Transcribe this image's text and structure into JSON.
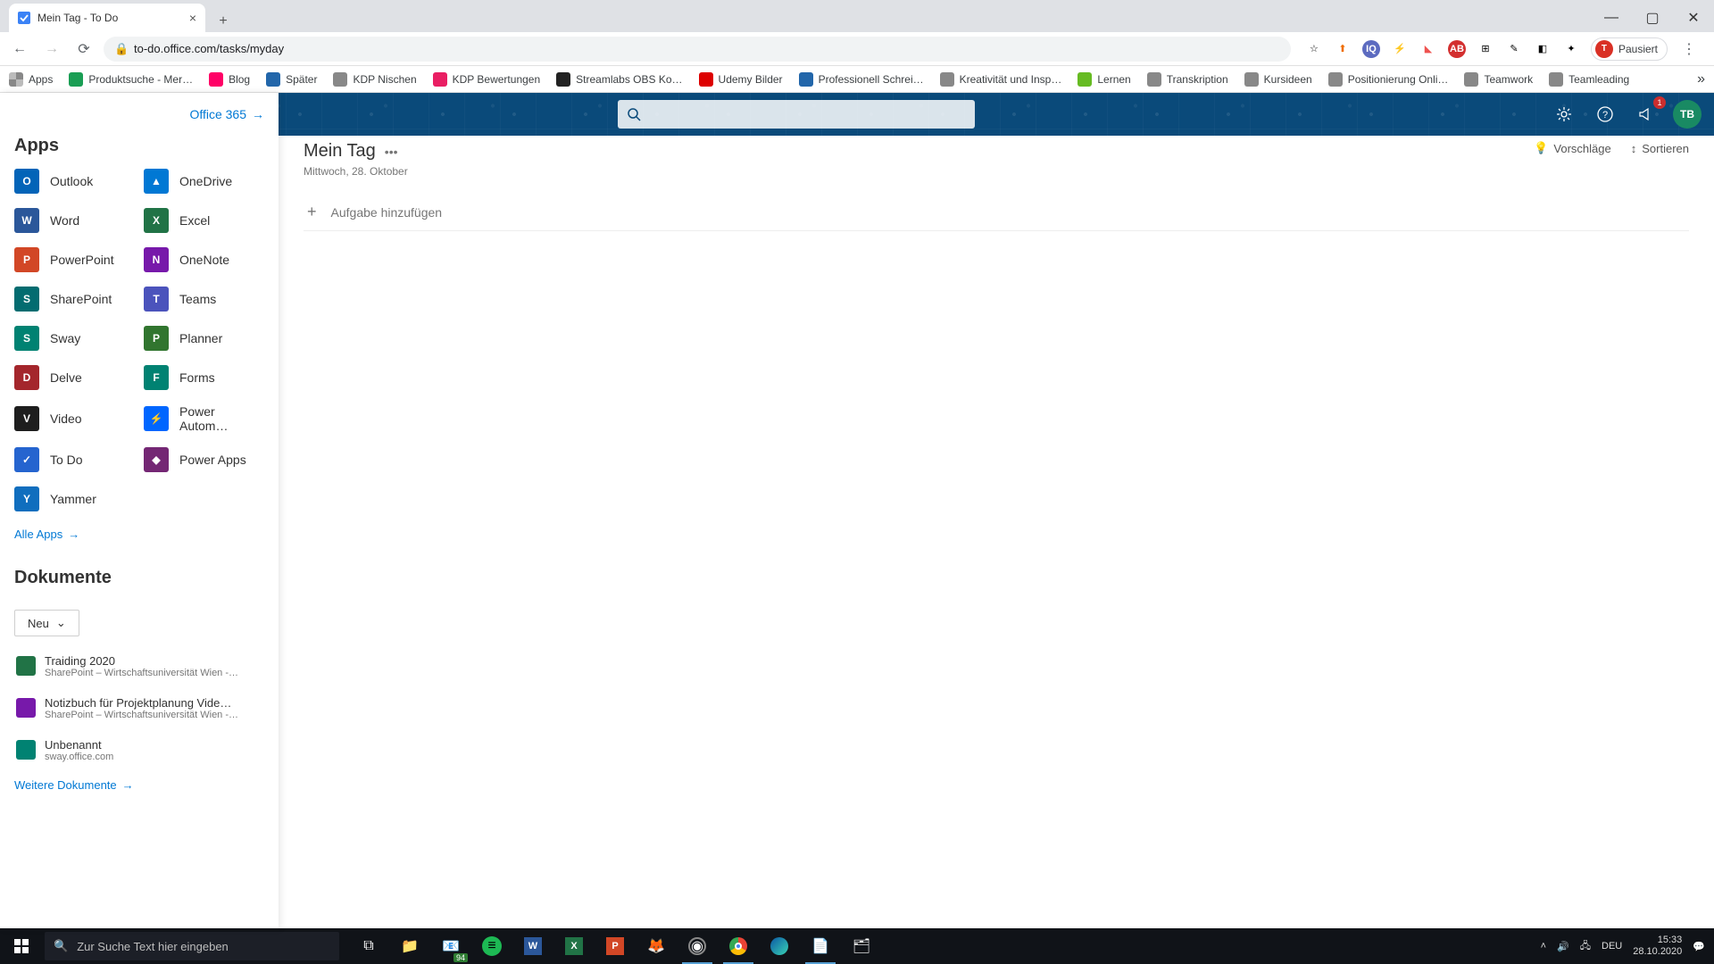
{
  "browser": {
    "tab_title": "Mein Tag - To Do",
    "url": "to-do.office.com/tasks/myday",
    "profile_status": "Pausiert",
    "profile_initial": "T",
    "apps_label": "Apps",
    "bookmarks": [
      "Produktsuche - Mer…",
      "Blog",
      "Später",
      "KDP Nischen",
      "KDP Bewertungen",
      "Streamlabs OBS Ko…",
      "Udemy Bilder",
      "Professionell Schrei…",
      "Kreativität und Insp…",
      "Lernen",
      "Transkription",
      "Kursideen",
      "Positionierung Onli…",
      "Teamwork",
      "Teamleading"
    ]
  },
  "office_header": {
    "notifications_count": "1",
    "avatar_initials": "TB"
  },
  "launcher": {
    "office_link": "Office 365",
    "apps_title": "Apps",
    "all_apps": "Alle Apps",
    "docs_title": "Dokumente",
    "new_label": "Neu",
    "more_docs": "Weitere Dokumente",
    "apps": [
      {
        "label": "Outlook",
        "cls": "c-outlook",
        "abbr": "O"
      },
      {
        "label": "OneDrive",
        "cls": "c-onedrive",
        "abbr": "▲"
      },
      {
        "label": "Word",
        "cls": "c-word",
        "abbr": "W"
      },
      {
        "label": "Excel",
        "cls": "c-excel",
        "abbr": "X"
      },
      {
        "label": "PowerPoint",
        "cls": "c-powerpoint",
        "abbr": "P"
      },
      {
        "label": "OneNote",
        "cls": "c-onenote",
        "abbr": "N"
      },
      {
        "label": "SharePoint",
        "cls": "c-sharepoint",
        "abbr": "S"
      },
      {
        "label": "Teams",
        "cls": "c-teams",
        "abbr": "T"
      },
      {
        "label": "Sway",
        "cls": "c-sway",
        "abbr": "S"
      },
      {
        "label": "Planner",
        "cls": "c-planner",
        "abbr": "P"
      },
      {
        "label": "Delve",
        "cls": "c-delve",
        "abbr": "D"
      },
      {
        "label": "Forms",
        "cls": "c-forms",
        "abbr": "F"
      },
      {
        "label": "Video",
        "cls": "c-video",
        "abbr": "V"
      },
      {
        "label": "Power Autom…",
        "cls": "c-automate",
        "abbr": "⚡"
      },
      {
        "label": "To Do",
        "cls": "c-todo",
        "abbr": "✓"
      },
      {
        "label": "Power Apps",
        "cls": "c-powerapps",
        "abbr": "◆"
      },
      {
        "label": "Yammer",
        "cls": "c-yammer",
        "abbr": "Y"
      }
    ],
    "documents": [
      {
        "title": "Traiding 2020",
        "subtitle": "SharePoint – Wirtschaftsuniversität Wien -…",
        "cls": "c-excel"
      },
      {
        "title": "Notizbuch für Projektplanung Vide…",
        "subtitle": "SharePoint – Wirtschaftsuniversität Wien -…",
        "cls": "c-onenote"
      },
      {
        "title": "Unbenannt",
        "subtitle": "sway.office.com",
        "cls": "c-sway"
      }
    ]
  },
  "todo": {
    "page_title": "Mein Tag",
    "date": "Mittwoch, 28. Oktober",
    "suggestions": "Vorschläge",
    "sort": "Sortieren",
    "add_task_placeholder": "Aufgabe hinzufügen"
  },
  "taskbar": {
    "search_placeholder": "Zur Suche Text hier eingeben",
    "mail_badge": "94",
    "lang": "DEU",
    "time": "15:33",
    "date": "28.10.2020"
  }
}
